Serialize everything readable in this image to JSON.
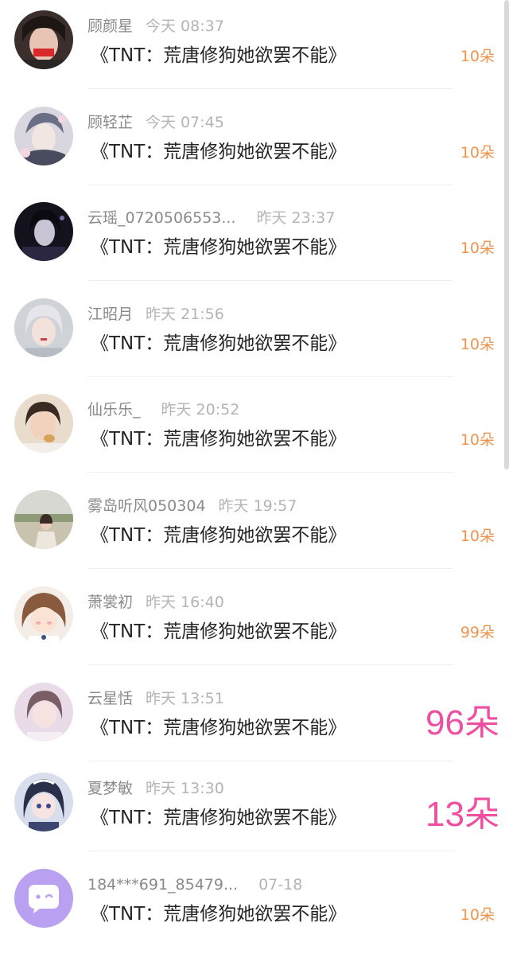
{
  "messages": [
    {
      "name": "顾颜星",
      "time": "今天 08:37",
      "title": "《TNT：荒唐修狗她欲罢不能》",
      "flowers": "10朵",
      "avatar": "avatar-girl-red-icon",
      "highlight": false
    },
    {
      "name": "顾轻芷",
      "time": "今天 07:45",
      "title": "《TNT：荒唐修狗她欲罢不能》",
      "flowers": "10朵",
      "avatar": "avatar-anime-boy-icon",
      "highlight": false
    },
    {
      "name": "云瑶_0720506553...",
      "time": "昨天 23:37",
      "title": "《TNT：荒唐修狗她欲罢不能》",
      "flowers": "10朵",
      "avatar": "avatar-dark-girl-icon",
      "highlight": false
    },
    {
      "name": "江昭月",
      "time": "昨天 21:56",
      "title": "《TNT：荒唐修狗她欲罢不能》",
      "flowers": "10朵",
      "avatar": "avatar-silver-hair-icon",
      "highlight": false
    },
    {
      "name": "仙乐乐_",
      "time": "昨天 20:52",
      "title": "《TNT：荒唐修狗她欲罢不能》",
      "flowers": "10朵",
      "avatar": "avatar-child-icon",
      "highlight": false
    },
    {
      "name": "雾岛听风050304",
      "time": "昨天 19:57",
      "title": "《TNT：荒唐修狗她欲罢不能》",
      "flowers": "10朵",
      "avatar": "avatar-outdoor-icon",
      "highlight": false
    },
    {
      "name": "萧裳初",
      "time": "昨天 16:40",
      "title": "《TNT：荒唐修狗她欲罢不能》",
      "flowers": "99朵",
      "avatar": "avatar-cartoon-girl-icon",
      "highlight": false
    },
    {
      "name": "云星恬",
      "time": "昨天 13:51",
      "title": "《TNT：荒唐修狗她欲罢不能》",
      "flowers": "96朵",
      "avatar": "avatar-soft-portrait-icon",
      "highlight": true
    },
    {
      "name": "夏梦敏",
      "time": "昨天 13:30",
      "title": "《TNT：荒唐修狗她欲罢不能》",
      "flowers": "13朵",
      "avatar": "avatar-anime-girl-icon",
      "highlight": true
    },
    {
      "name": "184***691_85479...",
      "time": "07-18",
      "title": "《TNT：荒唐修狗她欲罢不能》",
      "flowers": "10朵",
      "avatar": "chat-bubble-icon",
      "highlight": false
    }
  ],
  "colors": {
    "name": "#8a8a8a",
    "time": "#b4b4b4",
    "title": "#262626",
    "flowers": "#f0944d",
    "flowers_highlight": "#ee4fa0",
    "divider": "#efefef"
  }
}
